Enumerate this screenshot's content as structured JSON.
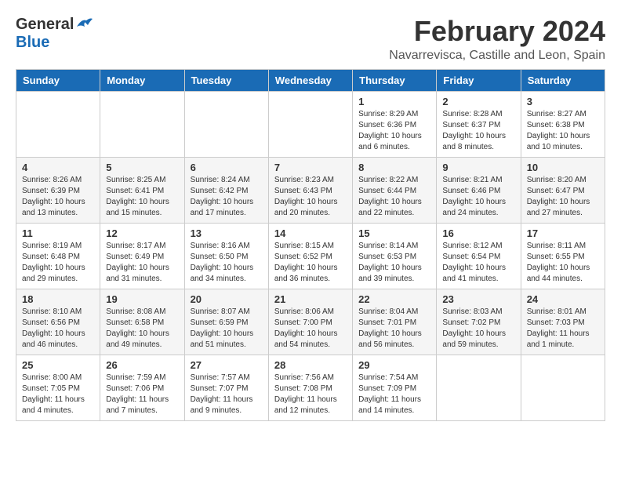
{
  "header": {
    "logo_general": "General",
    "logo_blue": "Blue",
    "month_title": "February 2024",
    "location": "Navarrevisca, Castille and Leon, Spain"
  },
  "days_of_week": [
    "Sunday",
    "Monday",
    "Tuesday",
    "Wednesday",
    "Thursday",
    "Friday",
    "Saturday"
  ],
  "weeks": [
    [
      {
        "day": "",
        "info": ""
      },
      {
        "day": "",
        "info": ""
      },
      {
        "day": "",
        "info": ""
      },
      {
        "day": "",
        "info": ""
      },
      {
        "day": "1",
        "info": "Sunrise: 8:29 AM\nSunset: 6:36 PM\nDaylight: 10 hours\nand 6 minutes."
      },
      {
        "day": "2",
        "info": "Sunrise: 8:28 AM\nSunset: 6:37 PM\nDaylight: 10 hours\nand 8 minutes."
      },
      {
        "day": "3",
        "info": "Sunrise: 8:27 AM\nSunset: 6:38 PM\nDaylight: 10 hours\nand 10 minutes."
      }
    ],
    [
      {
        "day": "4",
        "info": "Sunrise: 8:26 AM\nSunset: 6:39 PM\nDaylight: 10 hours\nand 13 minutes."
      },
      {
        "day": "5",
        "info": "Sunrise: 8:25 AM\nSunset: 6:41 PM\nDaylight: 10 hours\nand 15 minutes."
      },
      {
        "day": "6",
        "info": "Sunrise: 8:24 AM\nSunset: 6:42 PM\nDaylight: 10 hours\nand 17 minutes."
      },
      {
        "day": "7",
        "info": "Sunrise: 8:23 AM\nSunset: 6:43 PM\nDaylight: 10 hours\nand 20 minutes."
      },
      {
        "day": "8",
        "info": "Sunrise: 8:22 AM\nSunset: 6:44 PM\nDaylight: 10 hours\nand 22 minutes."
      },
      {
        "day": "9",
        "info": "Sunrise: 8:21 AM\nSunset: 6:46 PM\nDaylight: 10 hours\nand 24 minutes."
      },
      {
        "day": "10",
        "info": "Sunrise: 8:20 AM\nSunset: 6:47 PM\nDaylight: 10 hours\nand 27 minutes."
      }
    ],
    [
      {
        "day": "11",
        "info": "Sunrise: 8:19 AM\nSunset: 6:48 PM\nDaylight: 10 hours\nand 29 minutes."
      },
      {
        "day": "12",
        "info": "Sunrise: 8:17 AM\nSunset: 6:49 PM\nDaylight: 10 hours\nand 31 minutes."
      },
      {
        "day": "13",
        "info": "Sunrise: 8:16 AM\nSunset: 6:50 PM\nDaylight: 10 hours\nand 34 minutes."
      },
      {
        "day": "14",
        "info": "Sunrise: 8:15 AM\nSunset: 6:52 PM\nDaylight: 10 hours\nand 36 minutes."
      },
      {
        "day": "15",
        "info": "Sunrise: 8:14 AM\nSunset: 6:53 PM\nDaylight: 10 hours\nand 39 minutes."
      },
      {
        "day": "16",
        "info": "Sunrise: 8:12 AM\nSunset: 6:54 PM\nDaylight: 10 hours\nand 41 minutes."
      },
      {
        "day": "17",
        "info": "Sunrise: 8:11 AM\nSunset: 6:55 PM\nDaylight: 10 hours\nand 44 minutes."
      }
    ],
    [
      {
        "day": "18",
        "info": "Sunrise: 8:10 AM\nSunset: 6:56 PM\nDaylight: 10 hours\nand 46 minutes."
      },
      {
        "day": "19",
        "info": "Sunrise: 8:08 AM\nSunset: 6:58 PM\nDaylight: 10 hours\nand 49 minutes."
      },
      {
        "day": "20",
        "info": "Sunrise: 8:07 AM\nSunset: 6:59 PM\nDaylight: 10 hours\nand 51 minutes."
      },
      {
        "day": "21",
        "info": "Sunrise: 8:06 AM\nSunset: 7:00 PM\nDaylight: 10 hours\nand 54 minutes."
      },
      {
        "day": "22",
        "info": "Sunrise: 8:04 AM\nSunset: 7:01 PM\nDaylight: 10 hours\nand 56 minutes."
      },
      {
        "day": "23",
        "info": "Sunrise: 8:03 AM\nSunset: 7:02 PM\nDaylight: 10 hours\nand 59 minutes."
      },
      {
        "day": "24",
        "info": "Sunrise: 8:01 AM\nSunset: 7:03 PM\nDaylight: 11 hours\nand 1 minute."
      }
    ],
    [
      {
        "day": "25",
        "info": "Sunrise: 8:00 AM\nSunset: 7:05 PM\nDaylight: 11 hours\nand 4 minutes."
      },
      {
        "day": "26",
        "info": "Sunrise: 7:59 AM\nSunset: 7:06 PM\nDaylight: 11 hours\nand 7 minutes."
      },
      {
        "day": "27",
        "info": "Sunrise: 7:57 AM\nSunset: 7:07 PM\nDaylight: 11 hours\nand 9 minutes."
      },
      {
        "day": "28",
        "info": "Sunrise: 7:56 AM\nSunset: 7:08 PM\nDaylight: 11 hours\nand 12 minutes."
      },
      {
        "day": "29",
        "info": "Sunrise: 7:54 AM\nSunset: 7:09 PM\nDaylight: 11 hours\nand 14 minutes."
      },
      {
        "day": "",
        "info": ""
      },
      {
        "day": "",
        "info": ""
      }
    ]
  ]
}
